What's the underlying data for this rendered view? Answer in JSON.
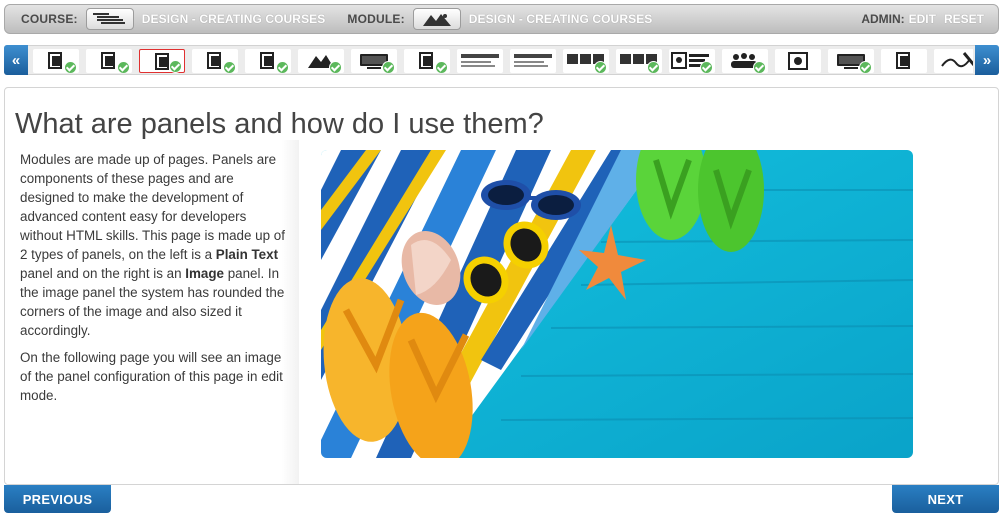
{
  "topbar": {
    "course_label": "COURSE:",
    "course_title": "DESIGN - CREATING COURSES",
    "module_label": "MODULE:",
    "module_title": "DESIGN - CREATING COURSES",
    "admin_label": "ADMIN:",
    "edit_label": "EDIT",
    "reset_label": "RESET"
  },
  "strip": {
    "prev_arrow": "«",
    "next_arrow": "»",
    "pages": [
      {
        "icon": "page-icon",
        "completed": true
      },
      {
        "icon": "page-icon",
        "completed": true
      },
      {
        "icon": "page-icon",
        "completed": true,
        "active": true
      },
      {
        "icon": "page-icon",
        "completed": true
      },
      {
        "icon": "page-icon",
        "completed": true
      },
      {
        "icon": "image-icon",
        "completed": true
      },
      {
        "icon": "screen-icon",
        "completed": true
      },
      {
        "icon": "page-icon",
        "completed": true
      },
      {
        "icon": "text-bar-icon",
        "completed": false
      },
      {
        "icon": "text-bar-icon",
        "completed": false
      },
      {
        "icon": "panels-icon",
        "completed": true
      },
      {
        "icon": "panels-icon",
        "completed": true
      },
      {
        "icon": "video-list-icon",
        "completed": true
      },
      {
        "icon": "people-icon",
        "completed": true
      },
      {
        "icon": "video-icon",
        "completed": false
      },
      {
        "icon": "screen-icon",
        "completed": true
      },
      {
        "icon": "page-icon",
        "completed": false
      },
      {
        "icon": "signature-icon",
        "completed": false
      }
    ]
  },
  "main": {
    "title": "What are panels and how do I use them?",
    "text": {
      "p1_a": "Modules are made up of pages. Panels are components of these pages and are designed to make the development of advanced content easy for developers without HTML skills. This page is made up of 2 types of panels, on the left is a ",
      "p1_b": "Plain Text",
      "p1_c": " panel and on the right is an ",
      "p1_d": "Image",
      "p1_e": " panel. In the image panel the system has rounded the corners of the image and also sized it accordingly.",
      "p2": "On the following page you will see an image of the panel configuration of this page in edit mode."
    }
  },
  "footer": {
    "previous_label": "PREVIOUS",
    "next_label": "NEXT"
  },
  "colors": {
    "accent_blue": "#1b5e9c",
    "check_green": "#5cb85c",
    "active_border": "#e03030"
  }
}
